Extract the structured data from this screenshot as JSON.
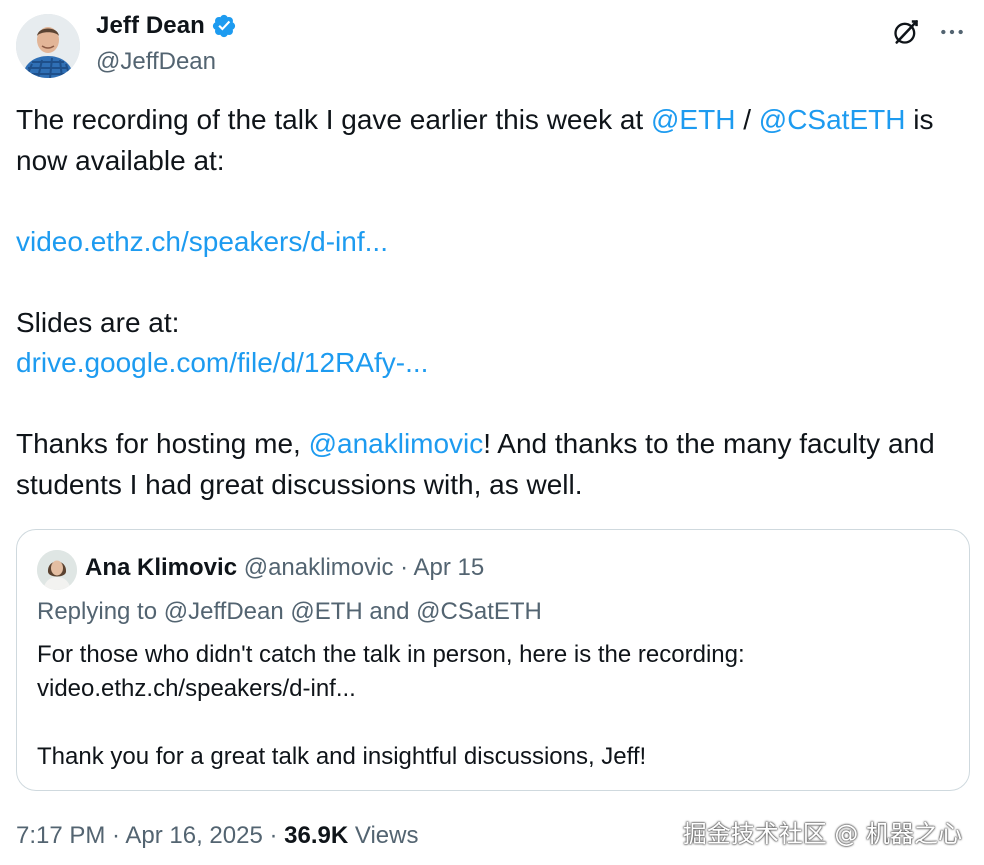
{
  "author": {
    "name": "Jeff Dean",
    "handle": "@JeffDean",
    "verified": true,
    "avatar_icon": "profile-photo-man-blue-plaid-shirt"
  },
  "header_icons": [
    "grok-icon",
    "more-icon"
  ],
  "tweet": {
    "line1_prefix": "The recording of the talk I gave earlier this week at ",
    "mention_eth": "@ETH",
    "slash": " / ",
    "mention_csateth": "@CSatETH",
    "line1_suffix": " is now available at:",
    "video_link": "video.ethz.ch/speakers/d-inf...",
    "slides_label": "Slides are at:",
    "slides_link": "drive.google.com/file/d/12RAfy-...",
    "thanks_prefix": "Thanks for hosting me, ",
    "mention_ana": "@anaklimovic",
    "thanks_suffix": "!  And thanks to the many faculty and students I had great discussions with, as well."
  },
  "quoted": {
    "name": "Ana Klimovic",
    "handle_date": " @anaklimovic · Apr 15",
    "replying": "Replying to @JeffDean @ETH and @CSatETH",
    "body_line1": "For those who didn't catch the talk in person, here is the recording:",
    "body_line2": "video.ethz.ch/speakers/d-inf...",
    "body_line3": "Thank you for a great talk and insightful discussions, Jeff!"
  },
  "footer": {
    "time_date": "7:17 PM · Apr 16, 2025 · ",
    "views_count": "36.9K",
    "views_label": " Views"
  },
  "watermark": "掘金技术社区 @ 机器之心",
  "colors": {
    "link": "#1d9bf0",
    "secondary": "#536471",
    "text": "#0f1419",
    "border": "#cfd9de"
  }
}
